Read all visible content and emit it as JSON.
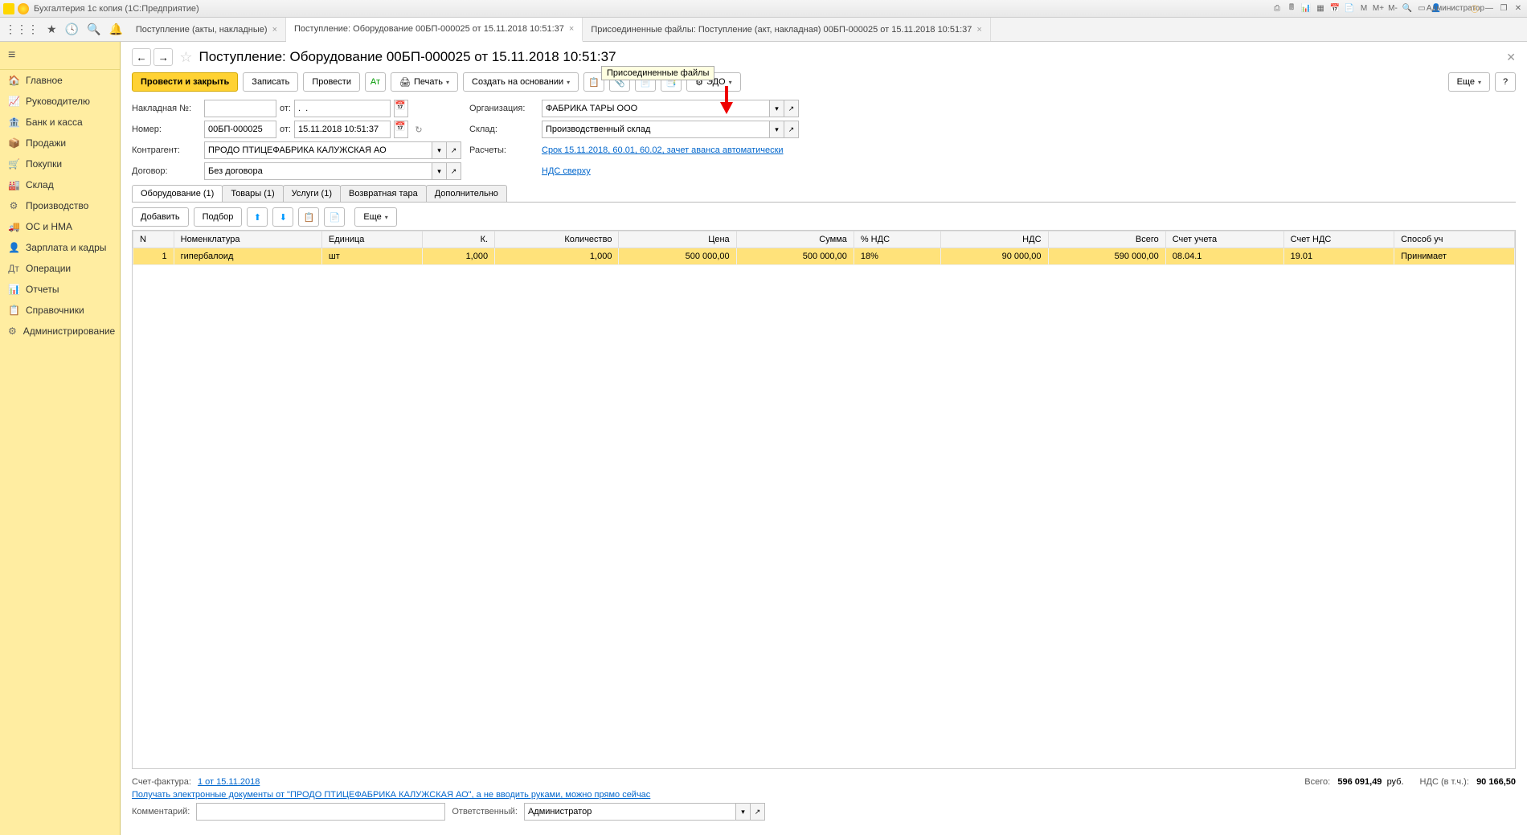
{
  "titlebar": {
    "app_title": "Бухгалтерия 1с копия  (1С:Предприятие)",
    "user": "Администратор",
    "m_labels": [
      "M",
      "M+",
      "M-"
    ]
  },
  "tabsbar": {
    "tabs": [
      {
        "label": "Поступление (акты, накладные)",
        "active": false
      },
      {
        "label": "Поступление: Оборудование 00БП-000025 от 15.11.2018 10:51:37",
        "active": true
      },
      {
        "label": "Присоединенные файлы: Поступление (акт, накладная) 00БП-000025 от 15.11.2018 10:51:37",
        "active": false
      }
    ]
  },
  "sidebar": {
    "items": [
      {
        "icon": "🏠",
        "label": "Главное"
      },
      {
        "icon": "📈",
        "label": "Руководителю"
      },
      {
        "icon": "🏦",
        "label": "Банк и касса"
      },
      {
        "icon": "📦",
        "label": "Продажи"
      },
      {
        "icon": "🛒",
        "label": "Покупки"
      },
      {
        "icon": "🏭",
        "label": "Склад"
      },
      {
        "icon": "⚙",
        "label": "Производство"
      },
      {
        "icon": "🚚",
        "label": "ОС и НМА"
      },
      {
        "icon": "👤",
        "label": "Зарплата и кадры"
      },
      {
        "icon": "Дт",
        "label": "Операции"
      },
      {
        "icon": "📊",
        "label": "Отчеты"
      },
      {
        "icon": "📋",
        "label": "Справочники"
      },
      {
        "icon": "⚙",
        "label": "Администрирование"
      }
    ]
  },
  "page": {
    "title": "Поступление: Оборудование 00БП-000025 от 15.11.2018 10:51:37",
    "tooltip": "Присоединенные файлы"
  },
  "toolbar": {
    "post_close": "Провести и закрыть",
    "save": "Записать",
    "post": "Провести",
    "print": "Печать",
    "create_based": "Создать на основании",
    "edo": "ЭДО",
    "more": "Еще"
  },
  "form": {
    "invoice_lbl": "Накладная  №:",
    "invoice_val": "",
    "from_lbl": "от:",
    "from_val": ".  .",
    "number_lbl": "Номер:",
    "number_val": "00БП-000025",
    "date_val": "15.11.2018 10:51:37",
    "org_lbl": "Организация:",
    "org_val": "ФАБРИКА ТАРЫ ООО",
    "warehouse_lbl": "Склад:",
    "warehouse_val": "Производственный склад",
    "contractor_lbl": "Контрагент:",
    "contractor_val": "ПРОДО ПТИЦЕФАБРИКА КАЛУЖСКАЯ АО",
    "calc_lbl": "Расчеты:",
    "calc_link": "Срок 15.11.2018, 60.01, 60.02, зачет аванса автоматически",
    "contract_lbl": "Договор:",
    "contract_val": "Без договора",
    "vat_link": "НДС сверху"
  },
  "subtabs": [
    "Оборудование (1)",
    "Товары (1)",
    "Услуги (1)",
    "Возвратная тара",
    "Дополнительно"
  ],
  "tabletb": {
    "add": "Добавить",
    "select": "Подбор",
    "more": "Еще"
  },
  "table": {
    "cols": [
      "N",
      "Номенклатура",
      "Единица",
      "К.",
      "Количество",
      "Цена",
      "Сумма",
      "% НДС",
      "НДС",
      "Всего",
      "Счет учета",
      "Счет НДС",
      "Способ уч"
    ],
    "rows": [
      {
        "n": "1",
        "nom": "гипербалоид",
        "unit": "шт",
        "k": "1,000",
        "qty": "1,000",
        "price": "500 000,00",
        "sum": "500 000,00",
        "vat_pct": "18%",
        "vat": "90 000,00",
        "total": "590 000,00",
        "acc": "08.04.1",
        "acc_vat": "19.01",
        "method": "Принимает"
      }
    ]
  },
  "footer": {
    "sf_lbl": "Счет-фактура:",
    "sf_link": "1 от 15.11.2018",
    "total_lbl": "Всего:",
    "total_val": "596 091,49",
    "currency": "руб.",
    "vat_lbl": "НДС (в т.ч.):",
    "vat_val": "90 166,50",
    "promo": "Получать электронные документы от \"ПРОДО ПТИЦЕФАБРИКА КАЛУЖСКАЯ АО\", а не вводить руками, можно прямо сейчас",
    "comment_lbl": "Комментарий:",
    "comment_val": "",
    "resp_lbl": "Ответственный:",
    "resp_val": "Администратор"
  }
}
